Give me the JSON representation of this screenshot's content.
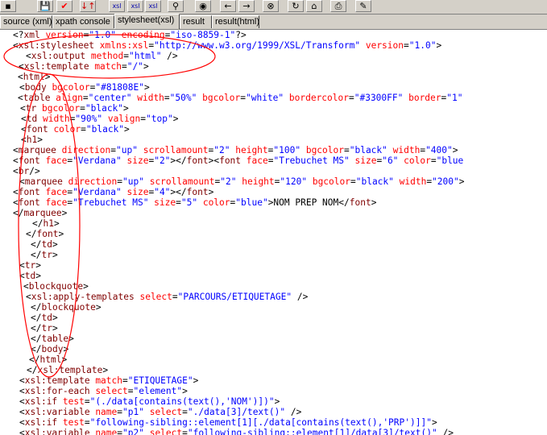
{
  "toolbar": {
    "buttons": [
      {
        "icon": "dots-icon",
        "glyph": "▪"
      },
      {
        "icon": "save-icon",
        "glyph": "💾"
      },
      {
        "icon": "check-icon",
        "glyph": "✔"
      },
      {
        "icon": "sort-icon",
        "glyph": "↓↑"
      },
      {
        "icon": "xsl-1-icon",
        "glyph": "xsl"
      },
      {
        "icon": "xsl-2-icon",
        "glyph": "xsl"
      },
      {
        "icon": "xsl-3-icon",
        "glyph": "xsl"
      },
      {
        "icon": "binoculars-icon",
        "glyph": "⚲"
      },
      {
        "icon": "globe-icon",
        "glyph": "◉"
      },
      {
        "icon": "back-icon",
        "glyph": "←"
      },
      {
        "icon": "forward-icon",
        "glyph": "→"
      },
      {
        "icon": "stop-icon",
        "glyph": "⊗"
      },
      {
        "icon": "refresh-icon",
        "glyph": "↻"
      },
      {
        "icon": "home-icon",
        "glyph": "⌂"
      },
      {
        "icon": "print-icon",
        "glyph": "⎙"
      },
      {
        "icon": "edit-icon",
        "glyph": "✎"
      }
    ],
    "colors": {
      "check": "#ff0000",
      "sort": "#cc0000",
      "xsl": "#0000aa"
    }
  },
  "tabs": [
    {
      "label": "source (xml)",
      "active": false
    },
    {
      "label": "xpath console",
      "active": false
    },
    {
      "label": "stylesheet(xsl)",
      "active": true
    },
    {
      "label": "result",
      "active": false
    },
    {
      "label": "result(html)",
      "active": false
    }
  ],
  "colors": {
    "tag": "#800000",
    "attribute": "#ff0000",
    "value": "#0000ff",
    "annotation_circle": "#ff0000"
  },
  "code_lines": [
    [
      [
        "x",
        "<?"
      ],
      [
        "t",
        "xml"
      ],
      [
        "a",
        " version"
      ],
      [
        "x",
        "="
      ],
      [
        "v",
        "\"1.0\""
      ],
      [
        "a",
        " encoding"
      ],
      [
        "x",
        "="
      ],
      [
        "v",
        "\"iso-8859-1\""
      ],
      [
        "x",
        "?>"
      ]
    ],
    [
      [
        "x",
        "<"
      ],
      [
        "t",
        "xsl:stylesheet"
      ],
      [
        "a",
        " xmlns:xsl"
      ],
      [
        "x",
        "="
      ],
      [
        "v",
        "\"http://www.w3.org/1999/XSL/Transform\""
      ],
      [
        "a",
        " version"
      ],
      [
        "x",
        "="
      ],
      [
        "v",
        "\"1.0\""
      ],
      [
        "x",
        ">"
      ]
    ],
    [
      [
        "x",
        "<"
      ],
      [
        "t",
        "xsl:output"
      ],
      [
        "a",
        " method"
      ],
      [
        "x",
        "="
      ],
      [
        "v",
        "\"html\""
      ],
      [
        "x",
        " />"
      ]
    ],
    [
      [
        "x",
        "<"
      ],
      [
        "t",
        "xsl:template"
      ],
      [
        "a",
        " match"
      ],
      [
        "x",
        "="
      ],
      [
        "v",
        "\"/\""
      ],
      [
        "x",
        ">"
      ]
    ],
    [
      [
        "x",
        "<"
      ],
      [
        "t",
        "html"
      ],
      [
        "x",
        ">"
      ]
    ],
    [
      [
        "x",
        "<"
      ],
      [
        "t",
        "body"
      ],
      [
        "a",
        " bgcolor"
      ],
      [
        "x",
        "="
      ],
      [
        "v",
        "\"#81808E\""
      ],
      [
        "x",
        ">"
      ]
    ],
    [
      [
        "x",
        "<"
      ],
      [
        "t",
        "table"
      ],
      [
        "a",
        " align"
      ],
      [
        "x",
        "="
      ],
      [
        "v",
        "\"center\""
      ],
      [
        "a",
        " width"
      ],
      [
        "x",
        "="
      ],
      [
        "v",
        "\"50%\""
      ],
      [
        "a",
        " bgcolor"
      ],
      [
        "x",
        "="
      ],
      [
        "v",
        "\"white\""
      ],
      [
        "a",
        " bordercolor"
      ],
      [
        "x",
        "="
      ],
      [
        "v",
        "\"#3300FF\""
      ],
      [
        "a",
        " border"
      ],
      [
        "x",
        "="
      ],
      [
        "v",
        "\"1\""
      ]
    ],
    [
      [
        "x",
        "<"
      ],
      [
        "t",
        "tr"
      ],
      [
        "a",
        " bgcolor"
      ],
      [
        "x",
        "="
      ],
      [
        "v",
        "\"black\""
      ],
      [
        "x",
        ">"
      ]
    ],
    [
      [
        "x",
        "<"
      ],
      [
        "t",
        "td"
      ],
      [
        "a",
        " width"
      ],
      [
        "x",
        "="
      ],
      [
        "v",
        "\"90%\""
      ],
      [
        "a",
        " valign"
      ],
      [
        "x",
        "="
      ],
      [
        "v",
        "\"top\""
      ],
      [
        "x",
        ">"
      ]
    ],
    [
      [
        "x",
        "<"
      ],
      [
        "t",
        "font"
      ],
      [
        "a",
        " color"
      ],
      [
        "x",
        "="
      ],
      [
        "v",
        "\"black\""
      ],
      [
        "x",
        ">"
      ]
    ],
    [
      [
        "x",
        "<"
      ],
      [
        "t",
        "h1"
      ],
      [
        "x",
        ">"
      ]
    ],
    [
      [
        "x",
        "<"
      ],
      [
        "t",
        "marquee"
      ],
      [
        "a",
        " direction"
      ],
      [
        "x",
        "="
      ],
      [
        "v",
        "\"up\""
      ],
      [
        "a",
        " scrollamount"
      ],
      [
        "x",
        "="
      ],
      [
        "v",
        "\"2\""
      ],
      [
        "a",
        " height"
      ],
      [
        "x",
        "="
      ],
      [
        "v",
        "\"100\""
      ],
      [
        "a",
        " bgcolor"
      ],
      [
        "x",
        "="
      ],
      [
        "v",
        "\"black\""
      ],
      [
        "a",
        " width"
      ],
      [
        "x",
        "="
      ],
      [
        "v",
        "\"400\""
      ],
      [
        "x",
        ">"
      ]
    ],
    [
      [
        "x",
        "<"
      ],
      [
        "t",
        "font"
      ],
      [
        "a",
        " face"
      ],
      [
        "x",
        "="
      ],
      [
        "v",
        "\"Verdana\""
      ],
      [
        "a",
        " size"
      ],
      [
        "x",
        "="
      ],
      [
        "v",
        "\"2\""
      ],
      [
        "x",
        "></"
      ],
      [
        "t",
        "font"
      ],
      [
        "x",
        "><"
      ],
      [
        "t",
        "font"
      ],
      [
        "a",
        " face"
      ],
      [
        "x",
        "="
      ],
      [
        "v",
        "\"Trebuchet MS\""
      ],
      [
        "a",
        " size"
      ],
      [
        "x",
        "="
      ],
      [
        "v",
        "\"6\""
      ],
      [
        "a",
        " color"
      ],
      [
        "x",
        "="
      ],
      [
        "v",
        "\"blue"
      ]
    ],
    [
      [
        "x",
        "<"
      ],
      [
        "t",
        "br"
      ],
      [
        "x",
        "/>"
      ]
    ],
    [
      [
        "x",
        "<"
      ],
      [
        "t",
        "marquee"
      ],
      [
        "a",
        " direction"
      ],
      [
        "x",
        "="
      ],
      [
        "v",
        "\"up\""
      ],
      [
        "a",
        " scrollamount"
      ],
      [
        "x",
        "="
      ],
      [
        "v",
        "\"2\""
      ],
      [
        "a",
        " height"
      ],
      [
        "x",
        "="
      ],
      [
        "v",
        "\"120\""
      ],
      [
        "a",
        " bgcolor"
      ],
      [
        "x",
        "="
      ],
      [
        "v",
        "\"black\""
      ],
      [
        "a",
        " width"
      ],
      [
        "x",
        "="
      ],
      [
        "v",
        "\"200\""
      ],
      [
        "x",
        ">"
      ]
    ],
    [
      [
        "x",
        "<"
      ],
      [
        "t",
        "font"
      ],
      [
        "a",
        " face"
      ],
      [
        "x",
        "="
      ],
      [
        "v",
        "\"Verdana\""
      ],
      [
        "a",
        " size"
      ],
      [
        "x",
        "="
      ],
      [
        "v",
        "\"4\""
      ],
      [
        "x",
        "></"
      ],
      [
        "t",
        "font"
      ],
      [
        "x",
        ">"
      ]
    ],
    [
      [
        "x",
        "<"
      ],
      [
        "t",
        "font"
      ],
      [
        "a",
        " face"
      ],
      [
        "x",
        "="
      ],
      [
        "v",
        "\"Trebuchet MS\""
      ],
      [
        "a",
        " size"
      ],
      [
        "x",
        "="
      ],
      [
        "v",
        "\"5\""
      ],
      [
        "a",
        " color"
      ],
      [
        "x",
        "="
      ],
      [
        "v",
        "\"blue\""
      ],
      [
        "x",
        ">NOM PREP NOM</"
      ],
      [
        "t",
        "font"
      ],
      [
        "x",
        ">"
      ]
    ],
    [
      [
        "x",
        "</"
      ],
      [
        "t",
        "marquee"
      ],
      [
        "x",
        ">"
      ]
    ],
    [
      [
        "x",
        "</"
      ],
      [
        "t",
        "h1"
      ],
      [
        "x",
        ">"
      ]
    ],
    [
      [
        "x",
        "</"
      ],
      [
        "t",
        "font"
      ],
      [
        "x",
        ">"
      ]
    ],
    [
      [
        "x",
        "</"
      ],
      [
        "t",
        "td"
      ],
      [
        "x",
        ">"
      ]
    ],
    [
      [
        "x",
        "</"
      ],
      [
        "t",
        "tr"
      ],
      [
        "x",
        ">"
      ]
    ],
    [
      [
        "x",
        "<"
      ],
      [
        "t",
        "tr"
      ],
      [
        "x",
        ">"
      ]
    ],
    [
      [
        "x",
        "<"
      ],
      [
        "t",
        "td"
      ],
      [
        "x",
        ">"
      ]
    ],
    [
      [
        "x",
        "<"
      ],
      [
        "t",
        "blockquote"
      ],
      [
        "x",
        ">"
      ]
    ],
    [
      [
        "x",
        "<"
      ],
      [
        "t",
        "xsl:apply-templates"
      ],
      [
        "a",
        " select"
      ],
      [
        "x",
        "="
      ],
      [
        "v",
        "\"PARCOURS/ETIQUETAGE\""
      ],
      [
        "x",
        " />"
      ]
    ],
    [
      [
        "x",
        "</"
      ],
      [
        "t",
        "blockquote"
      ],
      [
        "x",
        ">"
      ]
    ],
    [
      [
        "x",
        "</"
      ],
      [
        "t",
        "td"
      ],
      [
        "x",
        ">"
      ]
    ],
    [
      [
        "x",
        "</"
      ],
      [
        "t",
        "tr"
      ],
      [
        "x",
        ">"
      ]
    ],
    [
      [
        "x",
        "</"
      ],
      [
        "t",
        "table"
      ],
      [
        "x",
        ">"
      ]
    ],
    [
      [
        "x",
        "</"
      ],
      [
        "t",
        "body"
      ],
      [
        "x",
        ">"
      ]
    ],
    [
      [
        "x",
        "</"
      ],
      [
        "t",
        "html"
      ],
      [
        "x",
        ">"
      ]
    ],
    [
      [
        "x",
        "</"
      ],
      [
        "t",
        "xsl:template"
      ],
      [
        "x",
        ">"
      ]
    ],
    [
      [
        "x",
        "<"
      ],
      [
        "t",
        "xsl:template"
      ],
      [
        "a",
        " match"
      ],
      [
        "x",
        "="
      ],
      [
        "v",
        "\"ETIQUETAGE\""
      ],
      [
        "x",
        ">"
      ]
    ],
    [
      [
        "x",
        "<"
      ],
      [
        "t",
        "xsl:for-each"
      ],
      [
        "a",
        " select"
      ],
      [
        "x",
        "="
      ],
      [
        "v",
        "\"element\""
      ],
      [
        "x",
        ">"
      ]
    ],
    [
      [
        "x",
        "<"
      ],
      [
        "t",
        "xsl:if"
      ],
      [
        "a",
        " test"
      ],
      [
        "x",
        "="
      ],
      [
        "v",
        "\"(./data[contains(text(),'NOM')])\""
      ],
      [
        "x",
        ">"
      ]
    ],
    [
      [
        "x",
        "<"
      ],
      [
        "t",
        "xsl:variable"
      ],
      [
        "a",
        " name"
      ],
      [
        "x",
        "="
      ],
      [
        "v",
        "\"p1\""
      ],
      [
        "a",
        " select"
      ],
      [
        "x",
        "="
      ],
      [
        "v",
        "\"./data[3]/text()\""
      ],
      [
        "x",
        " />"
      ]
    ],
    [
      [
        "x",
        "<"
      ],
      [
        "t",
        "xsl:if"
      ],
      [
        "a",
        " test"
      ],
      [
        "x",
        "="
      ],
      [
        "v",
        "\"following-sibling::element[1][./data[contains(text(),'PRP')]]\""
      ],
      [
        "x",
        ">"
      ]
    ],
    [
      [
        "x",
        "<"
      ],
      [
        "t",
        "xsl:variable"
      ],
      [
        "a",
        " name"
      ],
      [
        "x",
        "="
      ],
      [
        "v",
        "\"p2\""
      ],
      [
        "a",
        " select"
      ],
      [
        "x",
        "="
      ],
      [
        "v",
        "\"following-sibling::element[1]/data[3]/text()\""
      ],
      [
        "x",
        " />"
      ]
    ]
  ]
}
